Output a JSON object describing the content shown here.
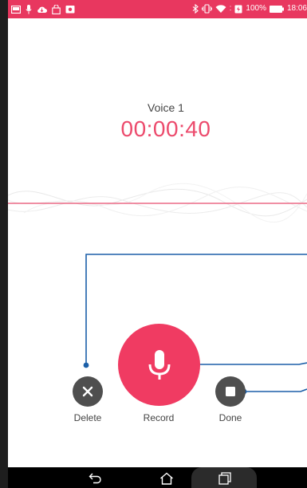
{
  "status_bar": {
    "left_icons": [
      "gallery-icon",
      "microphone-icon",
      "cloud-icon",
      "shopping-bag-icon",
      "photo-icon"
    ],
    "right_icons": [
      "bluetooth-icon",
      "vibrate-icon",
      "wifi-icon",
      "battery-charging-icon"
    ],
    "battery_percent": "100%",
    "time": "18:06",
    "color": "#e8375f"
  },
  "recording": {
    "title": "Voice 1",
    "timer": "00:00:40",
    "accent_color": "#ec4a6c"
  },
  "controls": {
    "delete_label": "Delete",
    "record_label": "Record",
    "done_label": "Done",
    "delete_icon": "close-icon",
    "record_icon": "microphone-icon",
    "done_icon": "stop-icon"
  },
  "nav_bar": {
    "icons": [
      "back-icon",
      "home-icon",
      "recent-apps-icon"
    ]
  }
}
